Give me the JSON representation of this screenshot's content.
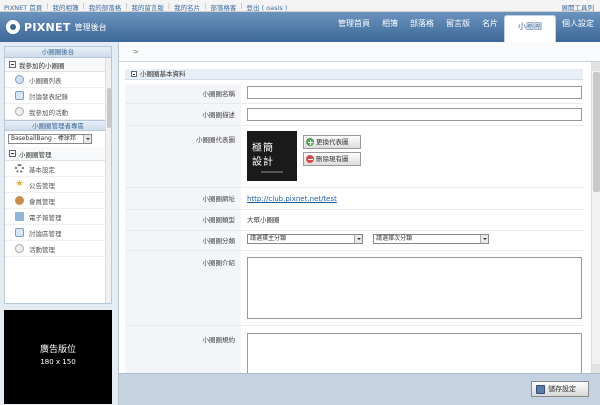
{
  "topbar": {
    "links": [
      "PIXNET 首頁",
      "我的相簿",
      "我的部落格",
      "我的留言版",
      "我的名片",
      "部落格客",
      "登出 ( oasis )"
    ],
    "toolbar": "展開工具列"
  },
  "header": {
    "brand": "PIXNET",
    "subtitle": "管理後台",
    "tabs": [
      "管理首頁",
      "相簿",
      "部落格",
      "留言版",
      "名片",
      "小圈圈",
      "個人設定"
    ],
    "active_tab": "小圈圈"
  },
  "sidebar": {
    "panel1_title": "小圈圈後台",
    "group1_title": "我參加的小圈圈",
    "group1_items": [
      "小圈圈列表",
      "討論發表紀錄",
      "我參加的活動"
    ],
    "panel2_title": "小圈圈管理者專區",
    "club_select": "BaseballBang - 棒球邦",
    "group2_title": "小圈圈管理",
    "group2_items": [
      "基本設定",
      "公告管理",
      "會員管理",
      "電子報管理",
      "討論區管理",
      "活動管理"
    ]
  },
  "ad": {
    "title": "廣告版位",
    "size": "180 x 150"
  },
  "main": {
    "breadcrumb": ">",
    "section_title": "小圈圈基本資料",
    "labels": {
      "name": "小圈圈名稱",
      "desc": "小圈圈描述",
      "image": "小圈圈代表圖",
      "url": "小圈圈網址",
      "type": "小圈圈類型",
      "category": "小圈圈分類",
      "intro": "小圈圈介紹",
      "rules": "小圈圈規約"
    },
    "avatar_line1": "極簡",
    "avatar_line2": "設計",
    "btn_change": "更換代表圖",
    "btn_delete": "刪除現有圖",
    "url_value": "http://club.pixnet.net/test",
    "type_value": "大眾小圈圈",
    "main_category": "請選擇主分類",
    "sub_category": "請選擇次分類",
    "save": "儲存設定"
  }
}
